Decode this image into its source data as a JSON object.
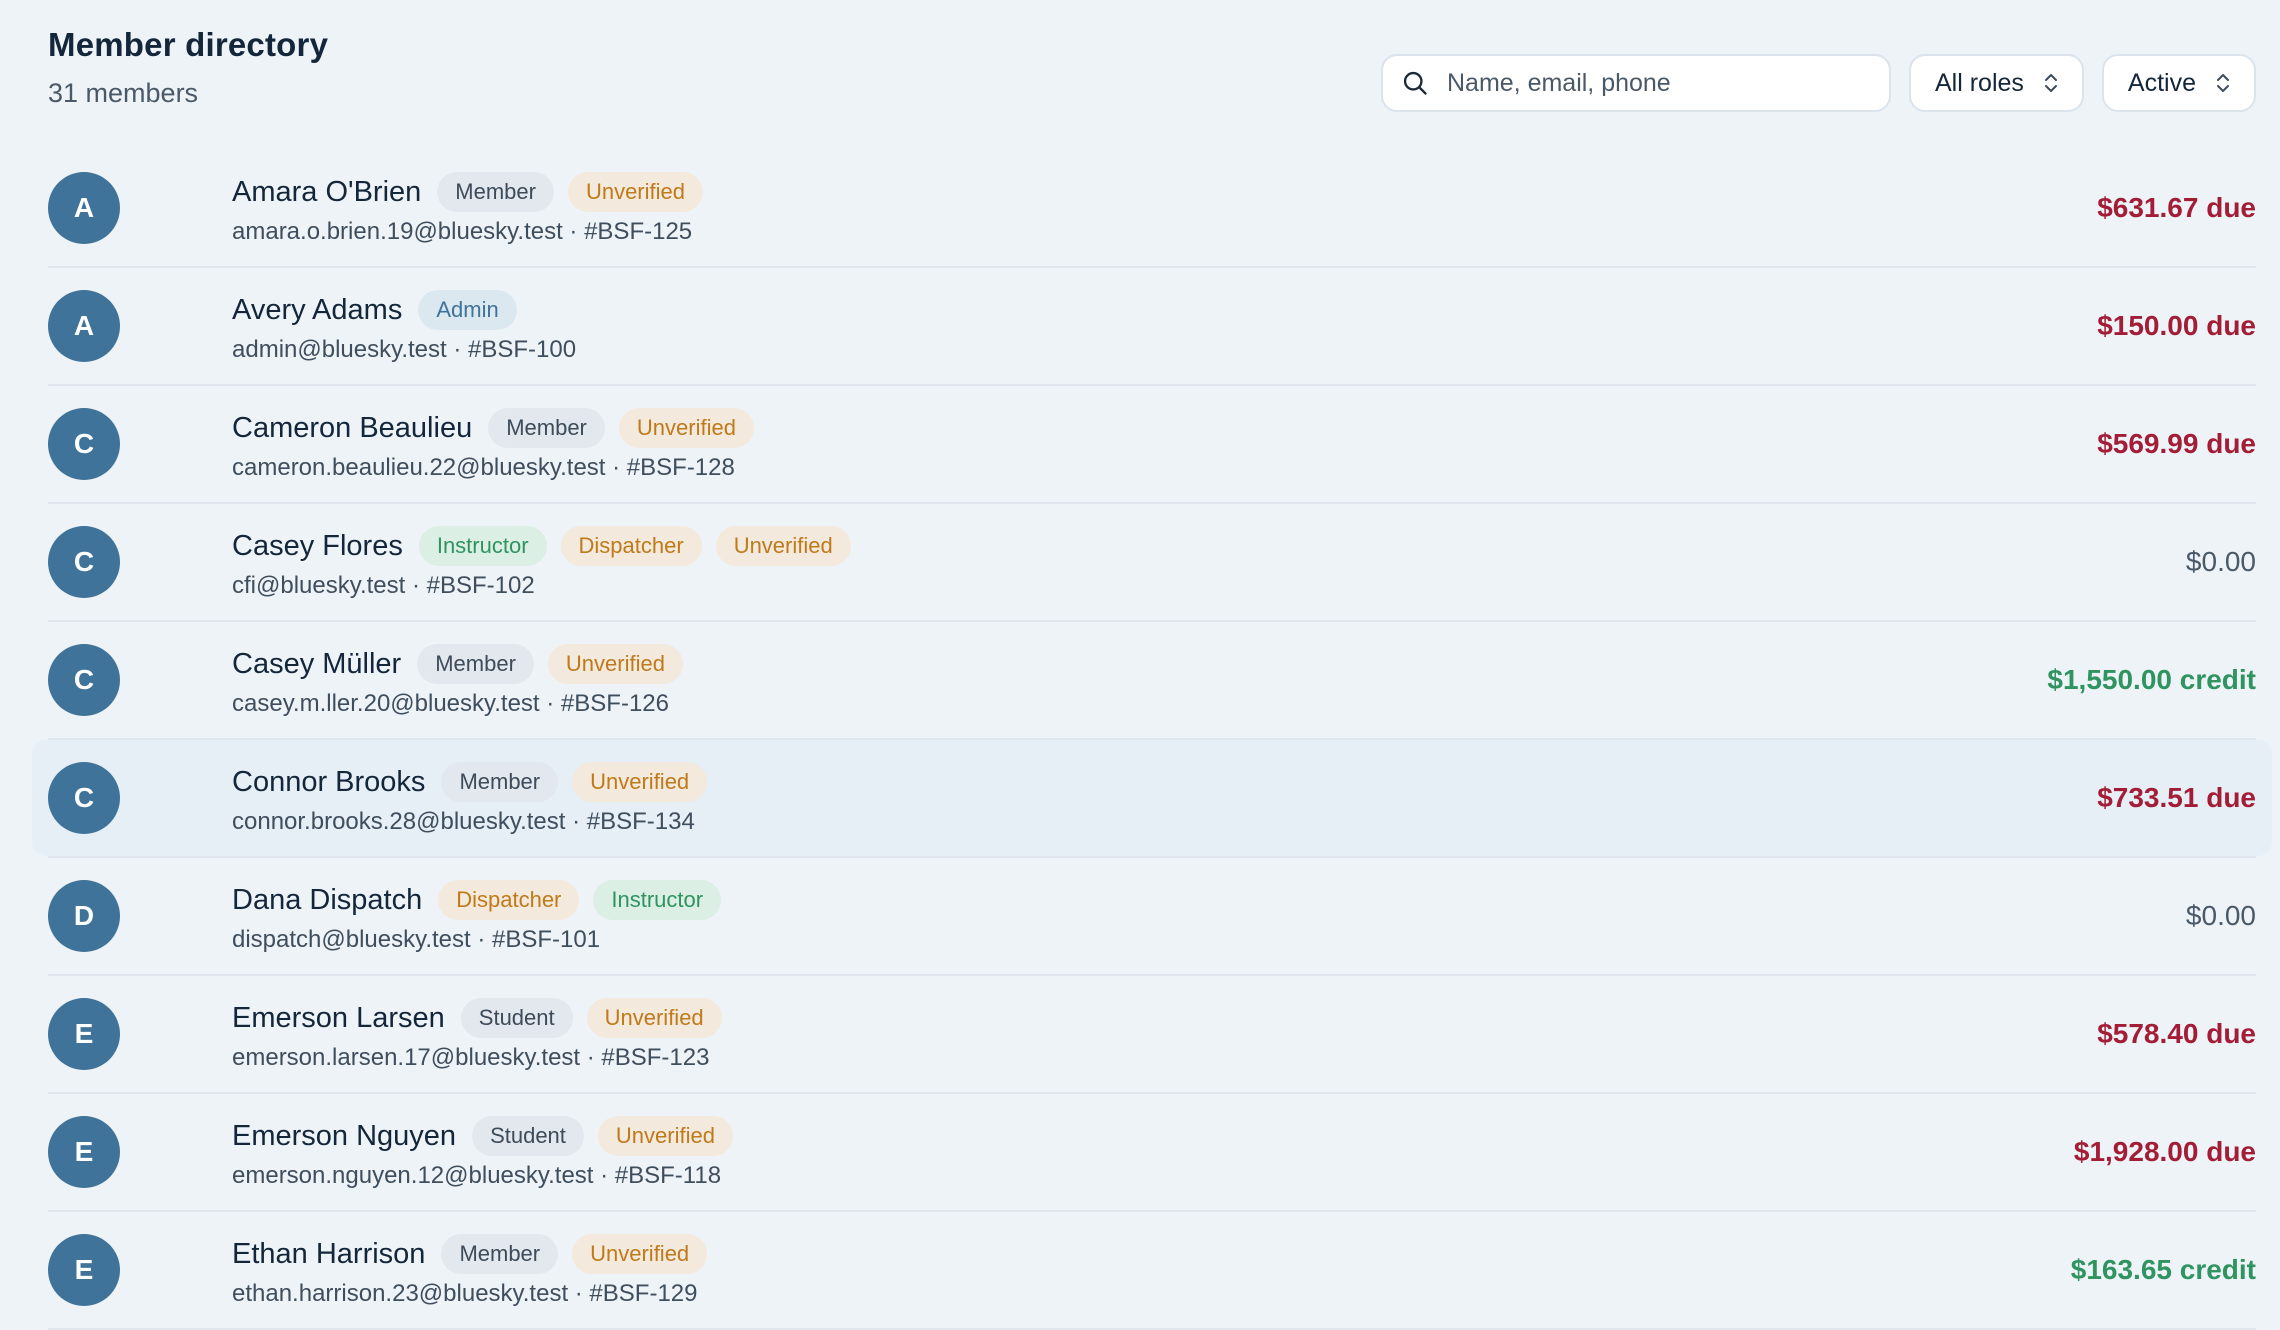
{
  "header": {
    "title": "Member directory",
    "count": "31 members"
  },
  "search": {
    "placeholder": "Name, email, phone",
    "value": ""
  },
  "filters": {
    "role": "All roles",
    "status": "Active"
  },
  "colors": {
    "avatar": "#3f7399",
    "due": "#a31d36",
    "credit": "#2f9460",
    "unverified": "#c07a1a"
  },
  "members": [
    {
      "initial": "A",
      "name": "Amara O'Brien",
      "badges": [
        {
          "label": "Member",
          "type": "member"
        },
        {
          "label": "Unverified",
          "type": "unverified"
        }
      ],
      "meta": "amara.o.brien.19@bluesky.test · #BSF-125",
      "balance": "$631.67 due",
      "balance_type": "due"
    },
    {
      "initial": "A",
      "name": "Avery Adams",
      "badges": [
        {
          "label": "Admin",
          "type": "admin"
        }
      ],
      "meta": "admin@bluesky.test · #BSF-100",
      "balance": "$150.00 due",
      "balance_type": "due"
    },
    {
      "initial": "C",
      "name": "Cameron Beaulieu",
      "badges": [
        {
          "label": "Member",
          "type": "member"
        },
        {
          "label": "Unverified",
          "type": "unverified"
        }
      ],
      "meta": "cameron.beaulieu.22@bluesky.test · #BSF-128",
      "balance": "$569.99 due",
      "balance_type": "due"
    },
    {
      "initial": "C",
      "name": "Casey Flores",
      "badges": [
        {
          "label": "Instructor",
          "type": "instructor"
        },
        {
          "label": "Dispatcher",
          "type": "dispatcher"
        },
        {
          "label": "Unverified",
          "type": "unverified"
        }
      ],
      "meta": "cfi@bluesky.test · #BSF-102",
      "balance": "$0.00",
      "balance_type": "zero"
    },
    {
      "initial": "C",
      "name": "Casey Müller",
      "badges": [
        {
          "label": "Member",
          "type": "member"
        },
        {
          "label": "Unverified",
          "type": "unverified"
        }
      ],
      "meta": "casey.m.ller.20@bluesky.test · #BSF-126",
      "balance": "$1,550.00 credit",
      "balance_type": "credit"
    },
    {
      "initial": "C",
      "name": "Connor Brooks",
      "badges": [
        {
          "label": "Member",
          "type": "member"
        },
        {
          "label": "Unverified",
          "type": "unverified"
        }
      ],
      "meta": "connor.brooks.28@bluesky.test · #BSF-134",
      "balance": "$733.51 due",
      "balance_type": "due",
      "highlight": true
    },
    {
      "initial": "D",
      "name": "Dana Dispatch",
      "badges": [
        {
          "label": "Dispatcher",
          "type": "dispatcher"
        },
        {
          "label": "Instructor",
          "type": "instructor"
        }
      ],
      "meta": "dispatch@bluesky.test · #BSF-101",
      "balance": "$0.00",
      "balance_type": "zero"
    },
    {
      "initial": "E",
      "name": "Emerson Larsen",
      "badges": [
        {
          "label": "Student",
          "type": "student"
        },
        {
          "label": "Unverified",
          "type": "unverified"
        }
      ],
      "meta": "emerson.larsen.17@bluesky.test · #BSF-123",
      "balance": "$578.40 due",
      "balance_type": "due"
    },
    {
      "initial": "E",
      "name": "Emerson Nguyen",
      "badges": [
        {
          "label": "Student",
          "type": "student"
        },
        {
          "label": "Unverified",
          "type": "unverified"
        }
      ],
      "meta": "emerson.nguyen.12@bluesky.test · #BSF-118",
      "balance": "$1,928.00 due",
      "balance_type": "due"
    },
    {
      "initial": "E",
      "name": "Ethan Harrison",
      "badges": [
        {
          "label": "Member",
          "type": "member"
        },
        {
          "label": "Unverified",
          "type": "unverified"
        }
      ],
      "meta": "ethan.harrison.23@bluesky.test · #BSF-129",
      "balance": "$163.65 credit",
      "balance_type": "credit"
    }
  ]
}
